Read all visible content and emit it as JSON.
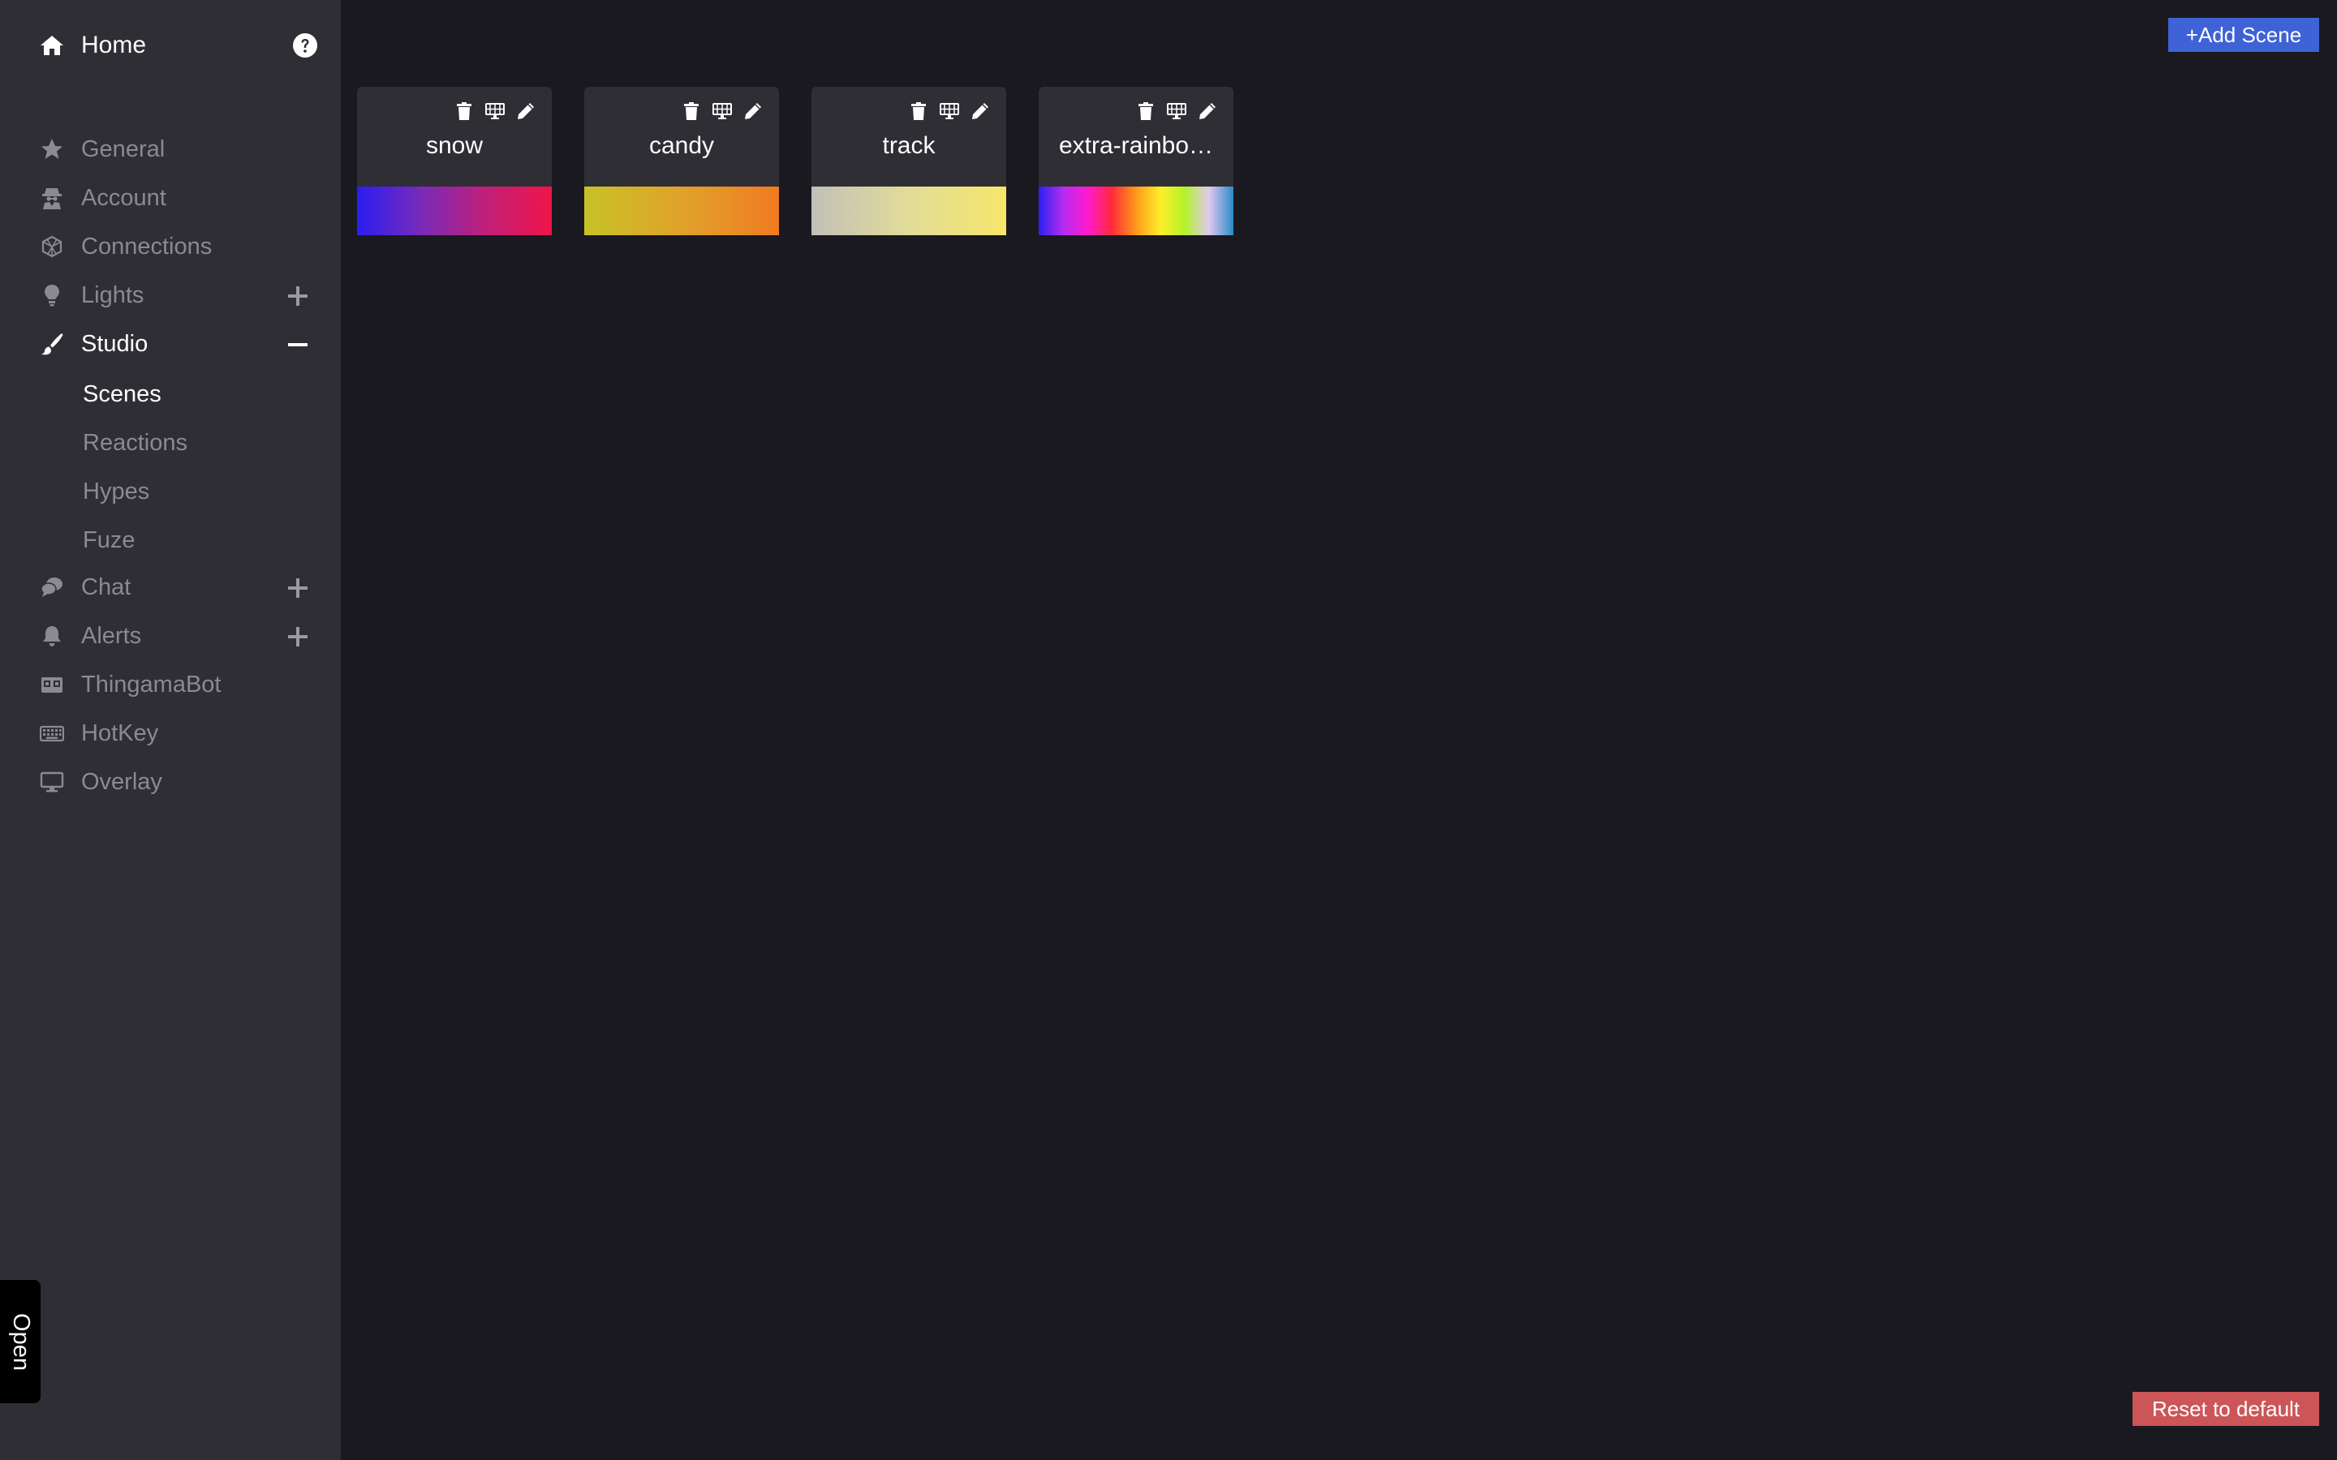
{
  "sidebar": {
    "home_label": "Home",
    "items": [
      {
        "label": "General",
        "icon": "star-icon"
      },
      {
        "label": "Account",
        "icon": "user-secret-icon"
      },
      {
        "label": "Connections",
        "icon": "connections-icon"
      },
      {
        "label": "Lights",
        "icon": "lightbulb-icon",
        "expander": "plus"
      },
      {
        "label": "Studio",
        "icon": "paintbrush-icon",
        "expander": "minus",
        "active": true
      },
      {
        "label": "Chat",
        "icon": "chat-icon",
        "expander": "plus"
      },
      {
        "label": "Alerts",
        "icon": "bell-icon",
        "expander": "plus"
      },
      {
        "label": "ThingamaBot",
        "icon": "robot-icon"
      },
      {
        "label": "HotKey",
        "icon": "keyboard-icon"
      },
      {
        "label": "Overlay",
        "icon": "monitor-icon"
      }
    ],
    "studio_subitems": [
      {
        "label": "Scenes",
        "active": true
      },
      {
        "label": "Reactions"
      },
      {
        "label": "Hypes"
      },
      {
        "label": "Fuze"
      }
    ],
    "open_tab_label": "Open"
  },
  "toolbar": {
    "add_scene_label": "+Add Scene"
  },
  "footer": {
    "reset_label": "Reset to default"
  },
  "scenes": [
    {
      "name": "snow",
      "gradient": [
        "#2b1ef0",
        "#7a2ab8",
        "#c21f78",
        "#ef1548"
      ]
    },
    {
      "name": "candy",
      "gradient": [
        "#c8c226",
        "#e0a22a",
        "#f07a22"
      ]
    },
    {
      "name": "track",
      "gradient": [
        "#c2c0b8",
        "#e2dc98",
        "#f7e66a"
      ]
    },
    {
      "name": "extra-rainbo…",
      "gradient": [
        "#2a22f0",
        "#b42cf0",
        "#ff1ad2",
        "#ff2a3a",
        "#ff9a1a",
        "#ffee2a",
        "#b4f22a",
        "#e0c8f0",
        "#2a8ac8"
      ]
    }
  ],
  "colors": {
    "background": "#1a191f",
    "sidebar": "#2e2e34",
    "add_button": "#3f62d6",
    "reset_button": "#cc5558"
  }
}
